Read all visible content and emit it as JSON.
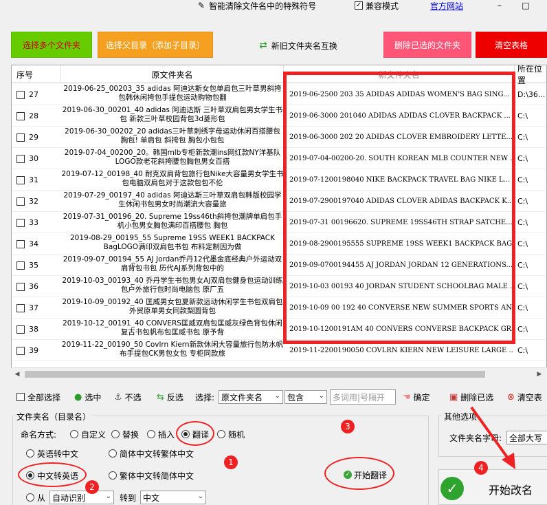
{
  "top": {
    "clean_special": "智能清除文件名中的特殊符号",
    "compat_mode": "兼容模式",
    "official_site": "官方网站",
    "min": "–",
    "max": "□"
  },
  "buttons": {
    "select_multi": "选择多个文件夹",
    "select_parent": "选择父目录（添加子目录）",
    "swap_names": "新旧文件夹名互换",
    "delete_selected": "删除已选的文件夹",
    "clear_table": "清空表格"
  },
  "table": {
    "headers": [
      "序号",
      "原文件夹名",
      "新文件夹名",
      "所在位置"
    ],
    "rows": [
      {
        "no": "27",
        "orig": "2019-06-25_00203_35 adidas 阿迪达斯女包单肩包三叶草男斜挎包韩休闲挎包手提包运动购物包翻",
        "new": "2019-06-2500 203 35 ADIDAS ADIDAS WOMEN'S BAG SING...",
        "loc": "D:\\36..."
      },
      {
        "no": "28",
        "orig": "2019-06-30_00201_40 adidas 阿迪达斯 三叶草双肩包男女学生书包 新款三叶草校园背包3d菱形包",
        "new": "2019-06-3000 201040 ADIDAS ADIDAS CLOVER BACKPACK ...",
        "loc": "C:\\"
      },
      {
        "no": "29",
        "orig": "2019-06-30_00202_20 adidas三叶草刺绣字母运动休闲百搭腰包胸包! 单肩包 斜挎包 胸包小包包",
        "new": "2019-06-3000 202 20 ADIDAS CLOVER EMBROIDERY LETTE...",
        "loc": "C:\\"
      },
      {
        "no": "30",
        "orig": "2019-07-04_00200_20。韩国mlb专柜新款潮ins网红款NY洋基队LOGO款老花斜挎腰包胸包男女百搭",
        "new": "2019-07-04-00200-20. SOUTH KOREAN MLB COUNTER NEW ...",
        "loc": "C:\\"
      },
      {
        "no": "31",
        "orig": "2019-07-12_00198_40 耐克双肩背包旅行包Nike大容量男女学生书包电脑双肩包对于这款包包不伦",
        "new": "2019-07-1200198040 NIKE BACKPACK TRAVEL BAG NIKE L...",
        "loc": "C:\\"
      },
      {
        "no": "32",
        "orig": "2019-07-29_00197_40 adidas 阿迪达斯三叶草双肩包韩版校园学生休闲书包男女时尚潮流大容量旅",
        "new": "2019-07-2900197040 ADIDAS CLOVER ADIDAS BACKPACK K...",
        "loc": "C:\\"
      },
      {
        "no": "33",
        "orig": "2019-07-31_00196_20. Supreme 19ss46th斜挎包潮牌单肩包手机小包男女胸包满印百搭腰包 胸包",
        "new": "2019-07-31 00196620. SUPREME 19SS46TH STRAP SATCHE...",
        "loc": "C:\\"
      },
      {
        "no": "34",
        "orig": "2019-08-29_00195_55 Supreme 19SS WEEK1 BACKPACK BagLOGO满印双肩包书包 布料定制因为做",
        "new": "2019-08-2900195555 SUPREME 19SS WEEK1 BACKPACK BAG...",
        "loc": "C:\\"
      },
      {
        "no": "35",
        "orig": "2019-09-07_00194_55 AJ Jordan乔丹12代墨金底经典户外运动双肩背包书包 历代AJ系列背包中的",
        "new": "2019-09-0700194455 AJ JORDAN JORDAN 12 GENERATIONS...",
        "loc": "C:\\"
      },
      {
        "no": "36",
        "orig": "2019-10-03_00193_40 乔丹学生书包男女AJ双肩包健身包运动训练包户外旅行包时尚电脑包 原厂五",
        "new": "2019-10-03 00193 40 JORDAN STUDENT SCHOOLBAG MALE ...",
        "loc": "C:\\"
      },
      {
        "no": "37",
        "orig": "2019-10-09_00192_40 匡威男女包夏新款运动休闲学生书包双肩包外贸原单男女同款梨圆背包 ",
        "new": "2019-10-09 00 192 40 CONVERSE NEW SUMMER SPORTS AN...",
        "loc": "C:\\"
      },
      {
        "no": "38",
        "orig": "2019-10-12_00191_40 CONVERS匡威双肩包匡威灰绿色背包休闲复古书包帆布包匡威书包 原予背",
        "new": "2019-10-1200191AM 40 CONVERS CONVERSE BACKPACK GRA...",
        "loc": "C:\\"
      },
      {
        "no": "39",
        "orig": "2019-11-22_00190_50 Covlrn Kiern新款休闲大容量旅行包防水帆布手提包CK男包女包 专柜同款旅",
        "new": "2019-11-2200190050 COVLRN KIERN NEW LEISURE LARGE ...",
        "loc": "C:\\"
      }
    ]
  },
  "toolbar": {
    "select_all": "全部选择",
    "check": "选中",
    "uncheck": "不选",
    "invert": "反选",
    "choose_label": "选择:",
    "field_select": "原文件夹名",
    "mode_select": "包含",
    "keyword_placeholder": "多词用|号隔开",
    "confirm": "确定",
    "delete_selected": "删除已选",
    "clear": "清空表"
  },
  "folder_group": {
    "title": "文件夹名（目录名）",
    "naming_label": "命名方式:",
    "modes": [
      "自定义",
      "替换",
      "插入",
      "翻译",
      "随机"
    ],
    "selected_mode": "翻译",
    "opt_en_to_cn": "英语转中文",
    "opt_s2t": "简体中文转繁体中文",
    "opt_cn_to_en": "中文转英语",
    "opt_t2s": "繁体中文转简体中文",
    "from_label": "从",
    "from_value": "自动识别",
    "to_label": "转到",
    "to_value": "中文",
    "start_translate": "开始翻译"
  },
  "other_group": {
    "title": "其他选项",
    "letters_label": "文件夹名字母:",
    "letters_value": "全部大写"
  },
  "start_rename": "开始改名",
  "annotations": {
    "badges": [
      "1",
      "2",
      "3",
      "4"
    ],
    "color": "#ee2222"
  }
}
